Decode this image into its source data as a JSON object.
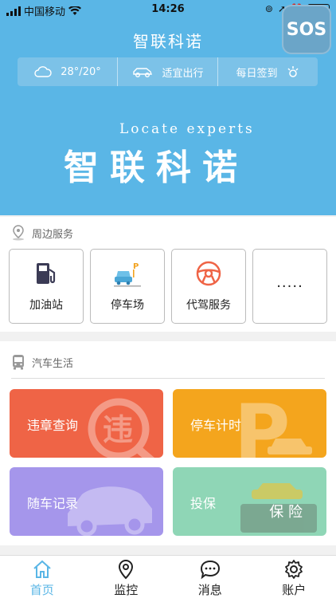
{
  "status_bar": {
    "carrier": "中国移动",
    "time": "14:26"
  },
  "header": {
    "title": "智联科诺",
    "sos_label": "SOS"
  },
  "banner": {
    "weather": "28°/20°",
    "travel_advice": "适宜出行",
    "checkin": "每日签到",
    "slogan_en": "Locate experts",
    "slogan_cn": "智联科诺"
  },
  "nearby": {
    "title": "周边服务",
    "items": [
      {
        "label": "加油站",
        "icon": "fuel-pump-icon"
      },
      {
        "label": "停车场",
        "icon": "parking-car-icon"
      },
      {
        "label": "代驾服务",
        "icon": "steering-wheel-icon"
      },
      {
        "label": "·····",
        "icon": "more-icon"
      }
    ]
  },
  "car_life": {
    "title": "汽车生活",
    "cards": [
      {
        "label": "违章查询",
        "color": "#ef6446"
      },
      {
        "label": "停车计时",
        "color": "#f4a51d"
      },
      {
        "label": "随车记录",
        "color": "#a596eb"
      },
      {
        "label": "投保",
        "color": "#8fd6b6",
        "badge": "保 险"
      }
    ]
  },
  "tabbar": {
    "items": [
      {
        "label": "首页",
        "icon": "home-icon",
        "active": true
      },
      {
        "label": "监控",
        "icon": "location-pin-icon"
      },
      {
        "label": "消息",
        "icon": "chat-bubble-icon"
      },
      {
        "label": "账户",
        "icon": "gear-icon"
      }
    ]
  },
  "colors": {
    "primary": "#5ab6e6",
    "banner_bar": "#7cc2e8"
  }
}
